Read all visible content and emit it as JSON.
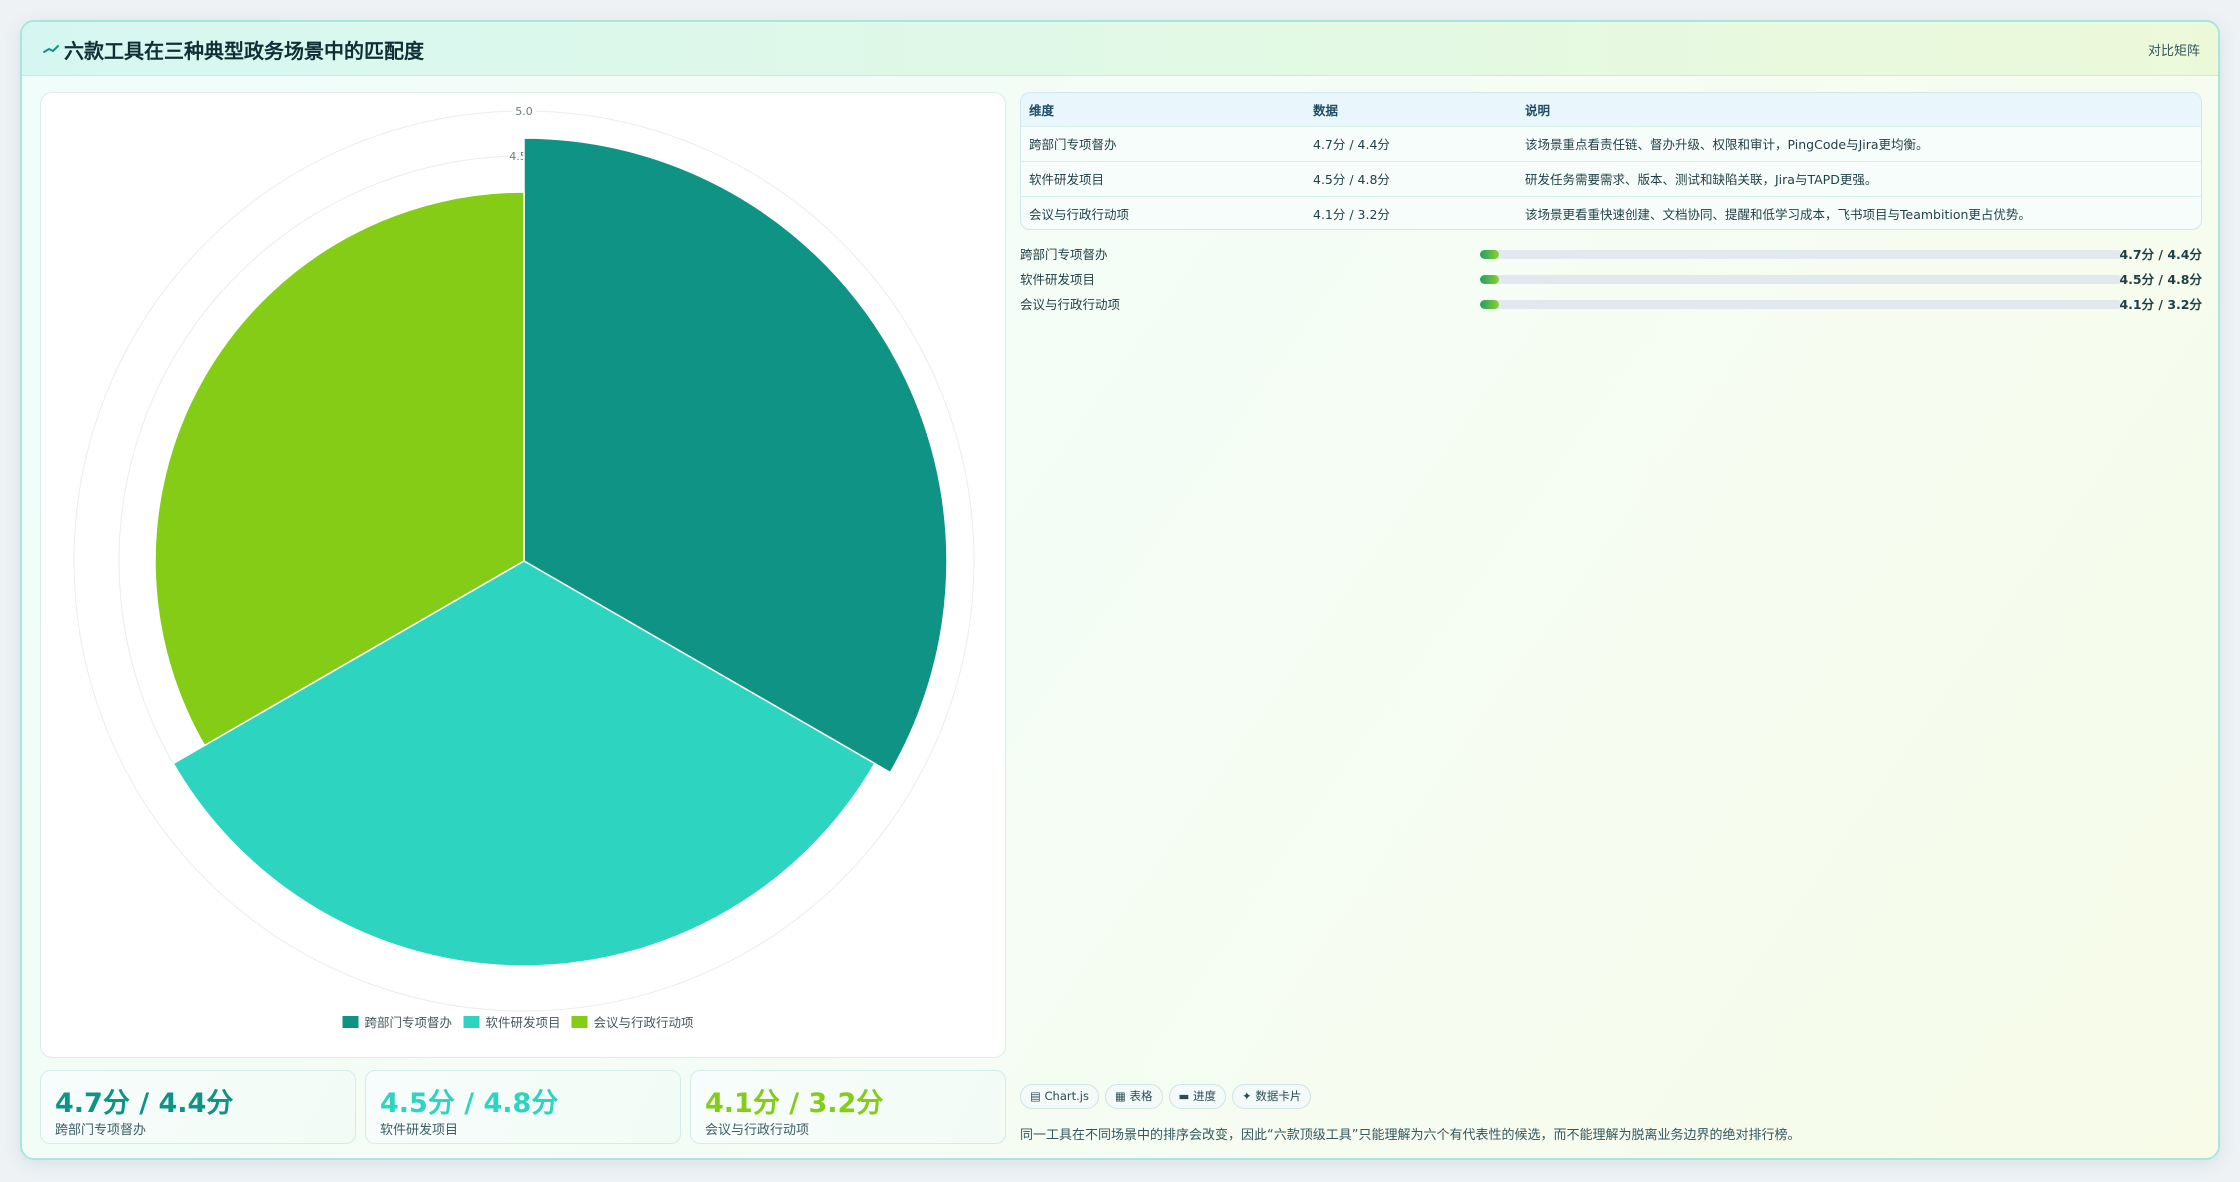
{
  "header": {
    "title": "六款工具在三种典型政务场景中的匹配度",
    "tag": "对比矩阵",
    "icon": "trend-line-icon"
  },
  "colors": {
    "s1": "#0e9384",
    "s2": "#2dd4bf",
    "s3": "#84cc16"
  },
  "chart_data": {
    "type": "polarArea",
    "r_tick_labels": [
      "5.0",
      "4.5"
    ],
    "r_range": [
      0,
      5
    ],
    "categories": [
      "跨部门专项督办",
      "软件研发项目",
      "会议与行政行动项"
    ],
    "values": [
      4.7,
      4.5,
      4.1
    ],
    "legend_position": "bottom"
  },
  "stats": [
    {
      "value": "4.7分 / 4.4分",
      "label": "跨部门专项督办"
    },
    {
      "value": "4.5分 / 4.8分",
      "label": "软件研发项目"
    },
    {
      "value": "4.1分 / 3.2分",
      "label": "会议与行政行动项"
    }
  ],
  "table": {
    "headers": [
      "维度",
      "数据",
      "说明"
    ],
    "rows": [
      {
        "dim": "跨部门专项督办",
        "data": "4.7分 / 4.4分",
        "note": "该场景重点看责任链、督办升级、权限和审计，PingCode与Jira更均衡。"
      },
      {
        "dim": "软件研发项目",
        "data": "4.5分 / 4.8分",
        "note": "研发任务需要需求、版本、测试和缺陷关联，Jira与TAPD更强。"
      },
      {
        "dim": "会议与行政行动项",
        "data": "4.1分 / 3.2分",
        "note": "该场景更看重快速创建、文档协同、提醒和低学习成本，飞书项目与Teambition更占优势。"
      }
    ]
  },
  "progress": [
    {
      "label": "跨部门专项督办",
      "value": "4.7分 / 4.4分",
      "fraction": 0.03
    },
    {
      "label": "软件研发项目",
      "value": "4.5分 / 4.8分",
      "fraction": 0.03
    },
    {
      "label": "会议与行政行动项",
      "value": "4.1分 / 3.2分",
      "fraction": 0.03
    }
  ],
  "chips": [
    "▤ Chart.js",
    "▦ 表格",
    "▬ 进度",
    "✦ 数据卡片"
  ],
  "footnote": "同一工具在不同场景中的排序会改变，因此“六款顶级工具”只能理解为六个有代表性的候选，而不能理解为脱离业务边界的绝对排行榜。"
}
